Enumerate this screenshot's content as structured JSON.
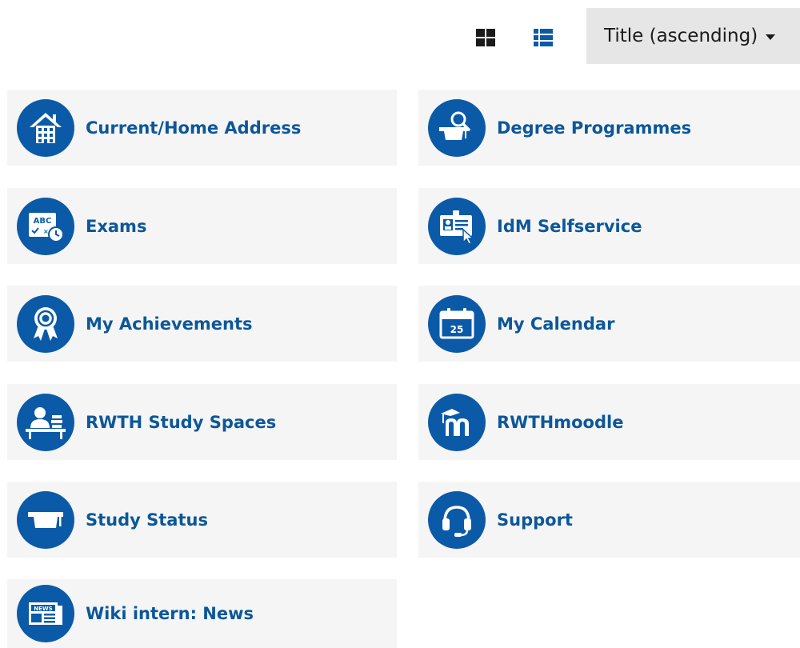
{
  "toolbar": {
    "grid_view_icon": "grid-view-icon",
    "list_view_icon": "list-view-icon",
    "sort_label": "Title (ascending)"
  },
  "tiles": [
    {
      "label": "Current/Home Address",
      "icon": "house-icon"
    },
    {
      "label": "Degree Programmes",
      "icon": "graduate-search-icon"
    },
    {
      "label": "Exams",
      "icon": "abc-clock-icon"
    },
    {
      "label": "IdM Selfservice",
      "icon": "id-card-cursor-icon"
    },
    {
      "label": "My Achievements",
      "icon": "award-ribbon-icon"
    },
    {
      "label": "My Calendar",
      "icon": "calendar-icon",
      "calendar_day": "25"
    },
    {
      "label": "RWTH Study Spaces",
      "icon": "student-desk-icon"
    },
    {
      "label": "RWTHmoodle",
      "icon": "moodle-logo-icon"
    },
    {
      "label": "Study Status",
      "icon": "mortarboard-icon"
    },
    {
      "label": "Support",
      "icon": "headset-icon"
    },
    {
      "label": "Wiki intern: News",
      "icon": "newspaper-icon",
      "news_text": "NEWS"
    }
  ],
  "colors": {
    "accent": "#0b5aa8",
    "label": "#0c5799",
    "tile_bg": "#f5f5f5",
    "sort_bg": "#e6e6e6"
  }
}
